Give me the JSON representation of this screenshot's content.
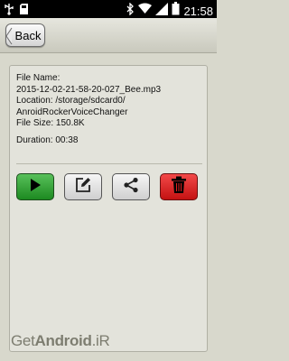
{
  "status_bar": {
    "time": "21:58",
    "left_icons": [
      "usb-icon",
      "sdcard-icon"
    ],
    "right_icons": [
      "bluetooth-icon",
      "wifi-icon",
      "signal-icon",
      "battery-icon"
    ]
  },
  "toolbar": {
    "back_label": "Back"
  },
  "file_info": {
    "name_label": "File Name:",
    "name_value": "2015-12-02-21-58-20-027_Bee.mp3",
    "location_label": "Location: /storage/sdcard0/",
    "location_value": "AnroidRockerVoiceChanger",
    "size": "File Size: 150.8K",
    "duration": "Duration: 00:38"
  },
  "actions": {
    "play": "play-icon",
    "edit": "edit-icon",
    "share": "share-icon",
    "delete": "trash-icon"
  },
  "colors": {
    "play": "#2ea232",
    "delete": "#e02020",
    "background": "#d8d8cc"
  },
  "watermark": {
    "prefix": "Get",
    "bold": "Android",
    "suffix": ".iR"
  }
}
